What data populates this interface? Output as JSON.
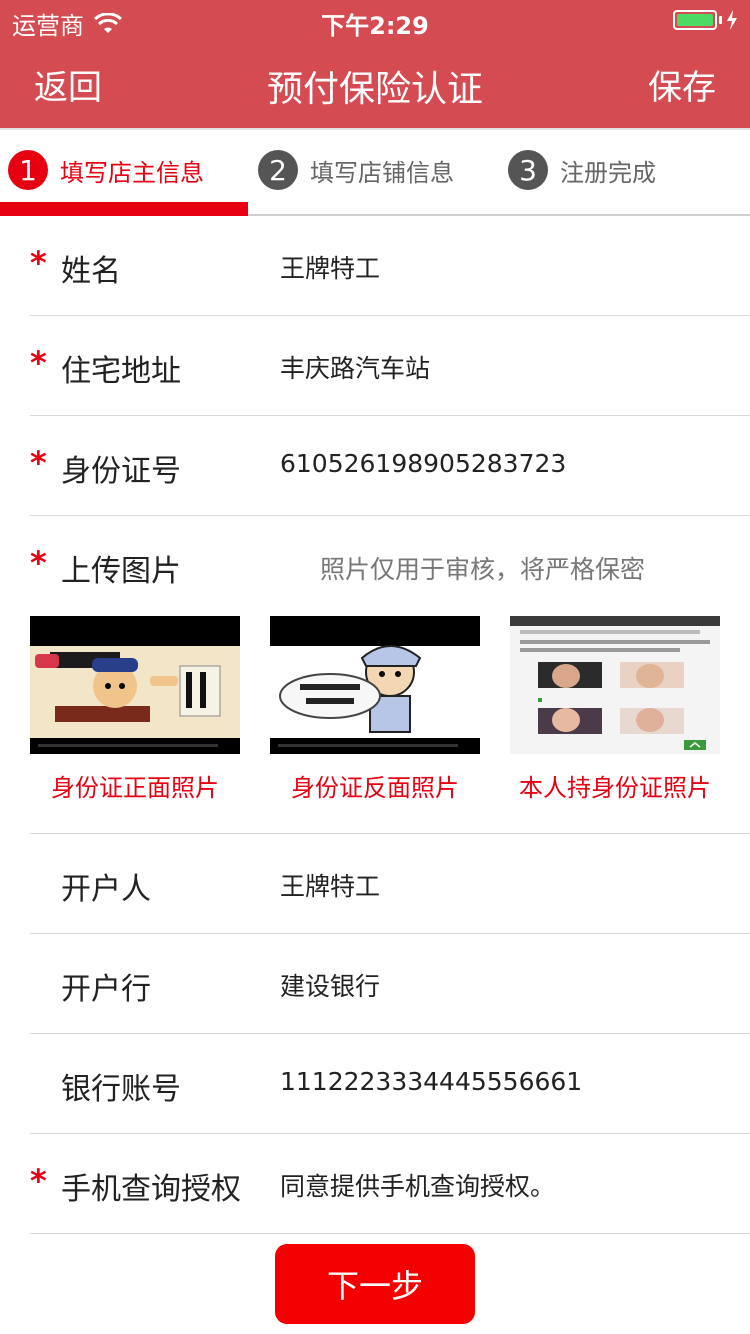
{
  "status_bar": {
    "carrier": "运营商",
    "time": "下午2:29"
  },
  "nav": {
    "back_label": "返回",
    "title": "预付保险认证",
    "save_label": "保存"
  },
  "steps": [
    {
      "number": "1",
      "label": "填写店主信息",
      "active": true
    },
    {
      "number": "2",
      "label": "填写店铺信息",
      "active": false
    },
    {
      "number": "3",
      "label": "注册完成",
      "active": false
    }
  ],
  "form": {
    "name": {
      "label": "姓名",
      "value": "王牌特工",
      "required": true
    },
    "address": {
      "label": "住宅地址",
      "value": "丰庆路汽车站",
      "required": true
    },
    "id_number": {
      "label": "身份证号",
      "value": "610526198905283723",
      "required": true
    },
    "upload": {
      "label": "上传图片",
      "hint": "照片仅用于审核，将严格保密",
      "required": true,
      "photos": [
        {
          "caption": "身份证正面照片"
        },
        {
          "caption": "身份证反面照片"
        },
        {
          "caption": "本人持身份证照片"
        }
      ]
    },
    "account_holder": {
      "label": "开户人",
      "value": "王牌特工",
      "required": false
    },
    "bank": {
      "label": "开户行",
      "value": "建设银行",
      "required": false
    },
    "account_number": {
      "label": "银行账号",
      "value": "1112223334445556661",
      "required": false
    },
    "phone_auth": {
      "label": "手机查询授权",
      "value": "同意提供手机查询授权。",
      "required": true
    }
  },
  "next_button": {
    "label": "下一步"
  },
  "required_mark": "*",
  "colors": {
    "header_bg": "#d44b52",
    "accent": "#e60012",
    "button": "#f40000"
  }
}
